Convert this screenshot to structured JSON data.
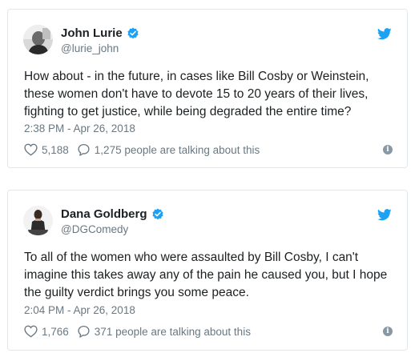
{
  "colors": {
    "brand_blue": "#1da1f2",
    "text_primary": "#1c2022",
    "text_secondary": "#697882",
    "border": "#e1e8ed"
  },
  "tweets": [
    {
      "author_name": "John Lurie",
      "handle": "@lurie_john",
      "verified_icon": "verified-badge-icon",
      "text": "How about - in the future, in cases like Bill Cosby or Weinstein, these women don't have to devote 15 to 20 years of their lives, fighting to get justice, while being degraded the entire time?",
      "timestamp": "2:38 PM - Apr 26, 2018",
      "likes": "5,188",
      "conversation": "1,275 people are talking about this"
    },
    {
      "author_name": "Dana Goldberg",
      "handle": "@DGComedy",
      "verified_icon": "verified-badge-icon",
      "text": "To all of the women who were assaulted by Bill Cosby, I can't imagine this takes away any of the pain he caused you, but I hope the guilty verdict brings you some peace.",
      "timestamp": "2:04 PM - Apr 26, 2018",
      "likes": "1,766",
      "conversation": "371 people are talking about this"
    }
  ]
}
